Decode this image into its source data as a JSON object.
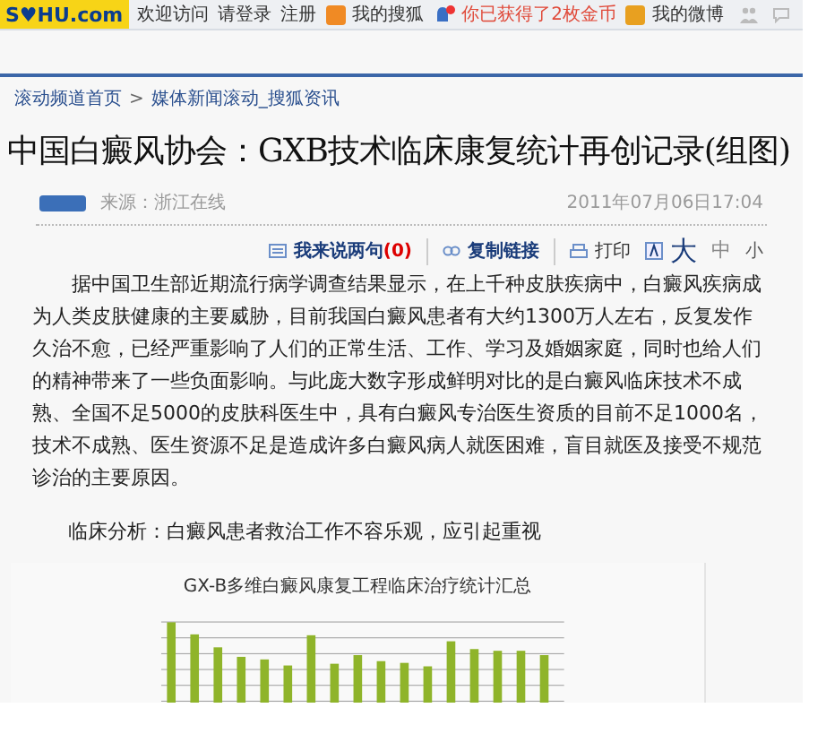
{
  "top_bar": {
    "logo": "S♥HU.com",
    "items": [
      {
        "kind": "text",
        "label": "欢迎访问"
      },
      {
        "kind": "link",
        "label": "请登录"
      },
      {
        "kind": "link",
        "label": "注册"
      },
      {
        "kind": "icon-link",
        "label": "我的搜狐",
        "color": "#f08a24"
      },
      {
        "kind": "alert",
        "label": "你已获得了2枚金币",
        "color": "#3a6fc4"
      },
      {
        "kind": "icon-link",
        "label": "我的微博",
        "color": "#e8a020"
      }
    ]
  },
  "breadcrumb": [
    {
      "label": "滚动频道首页"
    },
    {
      "label": "媒体新闻滚动_搜狐资讯"
    }
  ],
  "breadcrumb_separator": ">",
  "headline": "中国白癜风协会：GXB技术临床康复统计再创记录(组图)",
  "source": {
    "label": "来源：浙江在线",
    "date": "2011年07月06日17:04"
  },
  "tools": [
    {
      "kind": "comment",
      "label": "我来说两句",
      "count": "(0)"
    },
    {
      "kind": "copy",
      "label": "复制链接"
    },
    {
      "kind": "print",
      "label": "打印"
    },
    {
      "kind": "font-large",
      "label": "大"
    },
    {
      "kind": "font-medium",
      "label": "中"
    },
    {
      "kind": "font-small",
      "label": "小"
    }
  ],
  "paragraphs": [
    "据中国卫生部近期流行病学调查结果显示，在上千种皮肤疾病中，白癜风疾病成为人类皮肤健康的主要威胁，目前我国白癜风患者有大约1300万人左右，反复发作久治不愈，已经严重影响了人们的正常生活、工作、学习及婚姻家庭，同时也给人们的精神带来了一些负面影响。与此庞大数字形成鲜明对比的是白癜风临床技术不成熟、全国不足5000的皮肤科医生中，具有白癜风专治医生资质的目前不足1000名，技术不成熟、医生资源不足是造成许多白癜风病人就医困难，盲目就医及接受不规范诊治的主要原因。",
    "临床分析：白癜风患者救治工作不容乐观，应引起重视"
  ],
  "chart_image": {
    "title": "GX-B多维白癜风康复工程临床治疗统计汇总"
  }
}
